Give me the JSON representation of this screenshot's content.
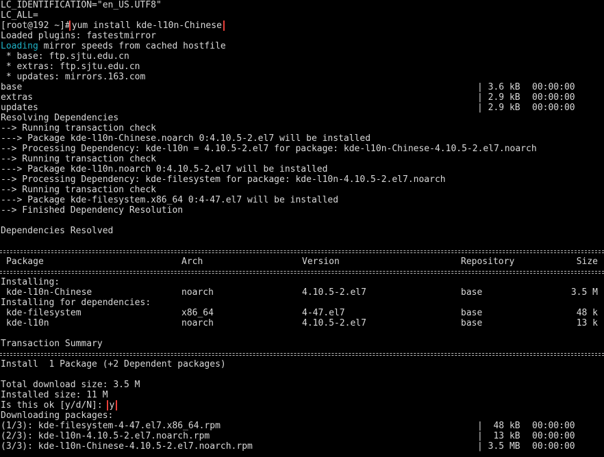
{
  "colors": {
    "background": "#000000",
    "text": "#d9d9d9",
    "loading": "#1fb3c7",
    "highlight_box": "#e8403a"
  },
  "terminal": {
    "lc_identification": "LC_IDENTIFICATION=\"en_US.UTF8\"",
    "lc_all": "LC_ALL=",
    "prompt": "[root@192 ~]#",
    "command": "yum install kde-l10n-Chinese",
    "loaded_plugins": "Loaded plugins: fastestmirror",
    "loading_word": "Loading",
    "loading_rest": " mirror speeds from cached hostfile",
    "mirrors": [
      " * base: ftp.sjtu.edu.cn",
      " * extras: ftp.sjtu.edu.cn",
      " * updates: mirrors.163.com"
    ],
    "repos": [
      {
        "name": "base",
        "size": "| 3.6 kB",
        "time": "00:00:00"
      },
      {
        "name": "extras",
        "size": "| 2.9 kB",
        "time": "00:00:00"
      },
      {
        "name": "updates",
        "size": "| 2.9 kB",
        "time": "00:00:00"
      }
    ],
    "resolve_lines": [
      "Resolving Dependencies",
      "--> Running transaction check",
      "---> Package kde-l10n-Chinese.noarch 0:4.10.5-2.el7 will be installed",
      "--> Processing Dependency: kde-l10n = 4.10.5-2.el7 for package: kde-l10n-Chinese-4.10.5-2.el7.noarch",
      "--> Running transaction check",
      "---> Package kde-l10n.noarch 0:4.10.5-2.el7 will be installed",
      "--> Processing Dependency: kde-filesystem for package: kde-l10n-4.10.5-2.el7.noarch",
      "--> Running transaction check",
      "---> Package kde-filesystem.x86_64 0:4-47.el7 will be installed",
      "--> Finished Dependency Resolution"
    ],
    "deps_resolved": "Dependencies Resolved",
    "table": {
      "headers": [
        "Package",
        "Arch",
        "Version",
        "Repository",
        "Size"
      ],
      "installing_label": "Installing:",
      "installing": [
        [
          "kde-l10n-Chinese",
          "noarch",
          "4.10.5-2.el7",
          "base",
          "3.5 M"
        ]
      ],
      "deps_label": "Installing for dependencies:",
      "deps": [
        [
          "kde-filesystem",
          "x86_64",
          "4-47.el7",
          "base",
          "48 k"
        ],
        [
          "kde-l10n",
          "noarch",
          "4.10.5-2.el7",
          "base",
          "13 k"
        ]
      ]
    },
    "transaction_summary": "Transaction Summary",
    "install_summary": "Install  1 Package (+2 Dependent packages)",
    "total_download": "Total download size: 3.5 M",
    "installed_size": "Installed size: 11 M",
    "confirm_prompt": "Is this ok [y/d/N]:",
    "confirm_answer": "y",
    "downloading": "Downloading packages:",
    "downloads": [
      {
        "name": "(1/3): kde-filesystem-4-47.el7.x86_64.rpm",
        "size": "|  48 kB",
        "time": "00:00:00"
      },
      {
        "name": "(2/3): kde-l10n-4.10.5-2.el7.noarch.rpm",
        "size": "|  13 kB",
        "time": "00:00:00"
      },
      {
        "name": "(3/3): kde-l10n-Chinese-4.10.5-2.el7.noarch.rpm",
        "size": "| 3.5 MB",
        "time": "00:00:00"
      }
    ]
  }
}
